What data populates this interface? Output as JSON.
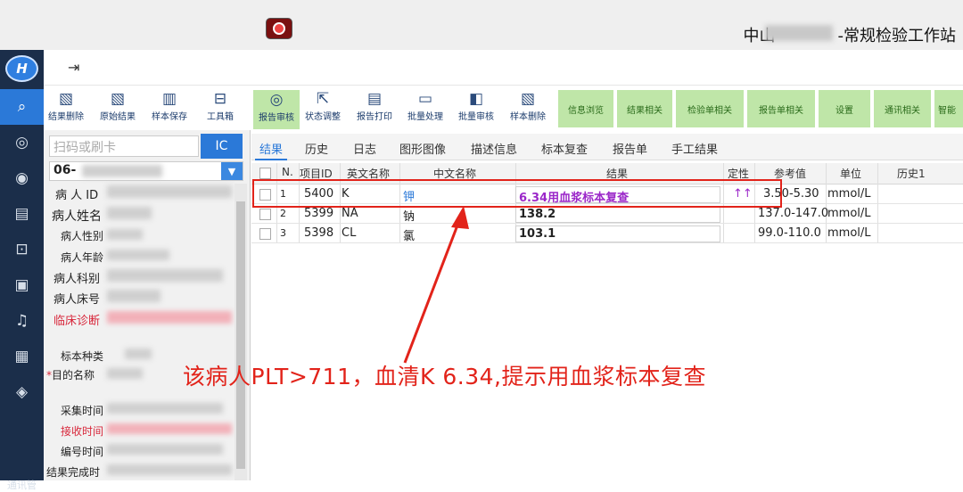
{
  "window": {
    "title": "中山",
    "title_suffix": "-常规检验工作站"
  },
  "menubar": {
    "toggle": "⇥"
  },
  "nav": {
    "label": "通讯管"
  },
  "toolbar": {
    "buttons": [
      "结果删除",
      "原始结果",
      "样本保存",
      "工具箱",
      "报告审核",
      "状态调整",
      "报告打印",
      "批量处理",
      "批量审核",
      "样本删除"
    ],
    "report_audit_sub": "[]",
    "green_buttons": [
      "信息浏览",
      "结果相关",
      "检验单相关",
      "报告单相关",
      "设置",
      "通讯相关",
      "智能"
    ]
  },
  "left": {
    "scan_placeholder": "扫码或刷卡",
    "ic_label": "IC",
    "sample_no": "06-",
    "fields": [
      "病 人 ID",
      "病人姓名",
      "病人性别",
      "病人年龄",
      "病人科别",
      "病人床号",
      "临床诊断",
      "标本种类",
      "目的名称",
      "采集时间",
      "接收时间",
      "编号时间",
      "结果完成时"
    ],
    "required_mark": "*"
  },
  "tabs": [
    "结果",
    "历史",
    "日志",
    "图形图像",
    "描述信息",
    "标本复查",
    "报告单",
    "手工结果"
  ],
  "grid": {
    "headers": [
      "N.",
      "项目ID",
      "英文名称",
      "中文名称",
      "结果",
      "定性",
      "参考值",
      "单位",
      "历史1"
    ],
    "rows": [
      {
        "n": "1",
        "id": "5400",
        "en": "K",
        "cn": "钾",
        "result": "6.34用血浆标本复查",
        "flag": "↑↑",
        "ref": "3.50-5.30",
        "unit": "mmol/L"
      },
      {
        "n": "2",
        "id": "5399",
        "en": "NA",
        "cn": "钠",
        "result": "138.2",
        "flag": "",
        "ref": "137.0-147.0",
        "unit": "mmol/L"
      },
      {
        "n": "3",
        "id": "5398",
        "en": "CL",
        "cn": "氯",
        "result": "103.1",
        "flag": "",
        "ref": "99.0-110.0",
        "unit": "mmol/L"
      }
    ]
  },
  "annotation": "该病人PLT>711，血清K 6.34,提示用血浆标本复查",
  "colors": {
    "highlight": "#e2231a",
    "accent": "#2b79d8",
    "flag": "#9b27c9"
  }
}
